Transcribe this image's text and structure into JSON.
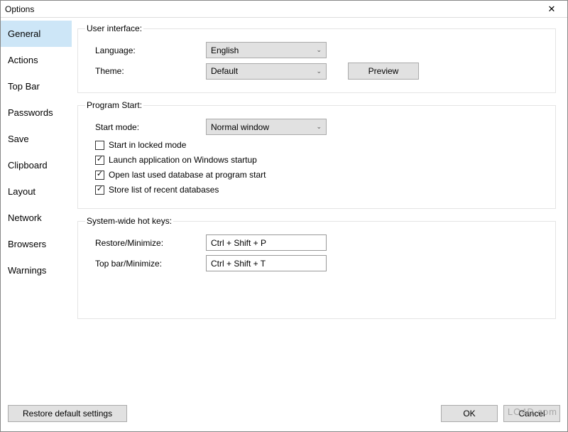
{
  "window": {
    "title": "Options",
    "close_glyph": "✕"
  },
  "sidebar": {
    "items": [
      {
        "label": "General"
      },
      {
        "label": "Actions"
      },
      {
        "label": "Top Bar"
      },
      {
        "label": "Passwords"
      },
      {
        "label": "Save"
      },
      {
        "label": "Clipboard"
      },
      {
        "label": "Layout"
      },
      {
        "label": "Network"
      },
      {
        "label": "Browsers"
      },
      {
        "label": "Warnings"
      }
    ],
    "active_index": 0
  },
  "sections": {
    "ui": {
      "legend": "User interface:",
      "language_label": "Language:",
      "language_value": "English",
      "theme_label": "Theme:",
      "theme_value": "Default",
      "preview_label": "Preview"
    },
    "start": {
      "legend": "Program Start:",
      "startmode_label": "Start mode:",
      "startmode_value": "Normal window",
      "checks": [
        {
          "label": "Start in locked mode",
          "checked": false
        },
        {
          "label": "Launch application on Windows startup",
          "checked": true
        },
        {
          "label": "Open last used database at program start",
          "checked": true
        },
        {
          "label": "Store list of recent databases",
          "checked": true
        }
      ]
    },
    "hotkeys": {
      "legend": "System-wide hot keys:",
      "restore_label": "Restore/Minimize:",
      "restore_value": "Ctrl + Shift + P",
      "topbar_label": "Top bar/Minimize:",
      "topbar_value": "Ctrl + Shift + T"
    }
  },
  "footer": {
    "restore_label": "Restore default settings",
    "ok_label": "OK",
    "cancel_label": "Cancel"
  },
  "watermark": "LO4D.com"
}
